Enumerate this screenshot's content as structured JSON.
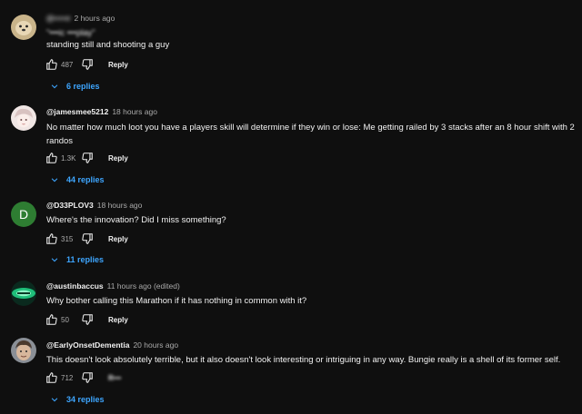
{
  "comments": [
    {
      "handle": "@•••••r",
      "time": "2 hours ago",
      "quote": "\"•••ic •••play\"",
      "text": "standing still and shooting a guy",
      "likes": "487",
      "reply_label": "Reply",
      "replies_label": "6 replies",
      "avatar": "dog-photo"
    },
    {
      "handle": "@jamesmee5212",
      "time": "18 hours ago",
      "text": "No matter how much loot you have a players skill will determine if they win or lose: Me getting railed by 3 stacks after an 8 hour shift with 2 randos",
      "likes": "1.3K",
      "reply_label": "Reply",
      "replies_label": "44 replies",
      "avatar": "anime-portrait"
    },
    {
      "handle": "@D33PLOV3",
      "time": "18 hours ago",
      "text": "Where's the innovation?  Did I miss something?",
      "likes": "315",
      "reply_label": "Reply",
      "replies_label": "11 replies",
      "avatar_letter": "D",
      "avatar_color": "#2e7d32"
    },
    {
      "handle": "@austinbaccus",
      "time": "11 hours ago (edited)",
      "text": "Why bother calling this Marathon if it has nothing in common with it?",
      "likes": "50",
      "reply_label": "Reply",
      "avatar": "green-glow"
    },
    {
      "handle": "@EarlyOnsetDementia",
      "time": "20 hours ago",
      "text": "This doesn't look absolutely terrible, but it also doesn't look interesting or intriguing in any way. Bungie really is a shell of its former self.",
      "likes": "712",
      "reply_label": "R•••",
      "replies_label": "34 replies",
      "avatar": "face-photo"
    }
  ],
  "colors": {
    "background": "#0f0f0f",
    "text": "#f1f1f1",
    "meta": "#aaaaaa",
    "link": "#3ea6ff"
  },
  "icons": [
    "thumbs-up-icon",
    "thumbs-down-icon",
    "chevron-down-icon"
  ]
}
